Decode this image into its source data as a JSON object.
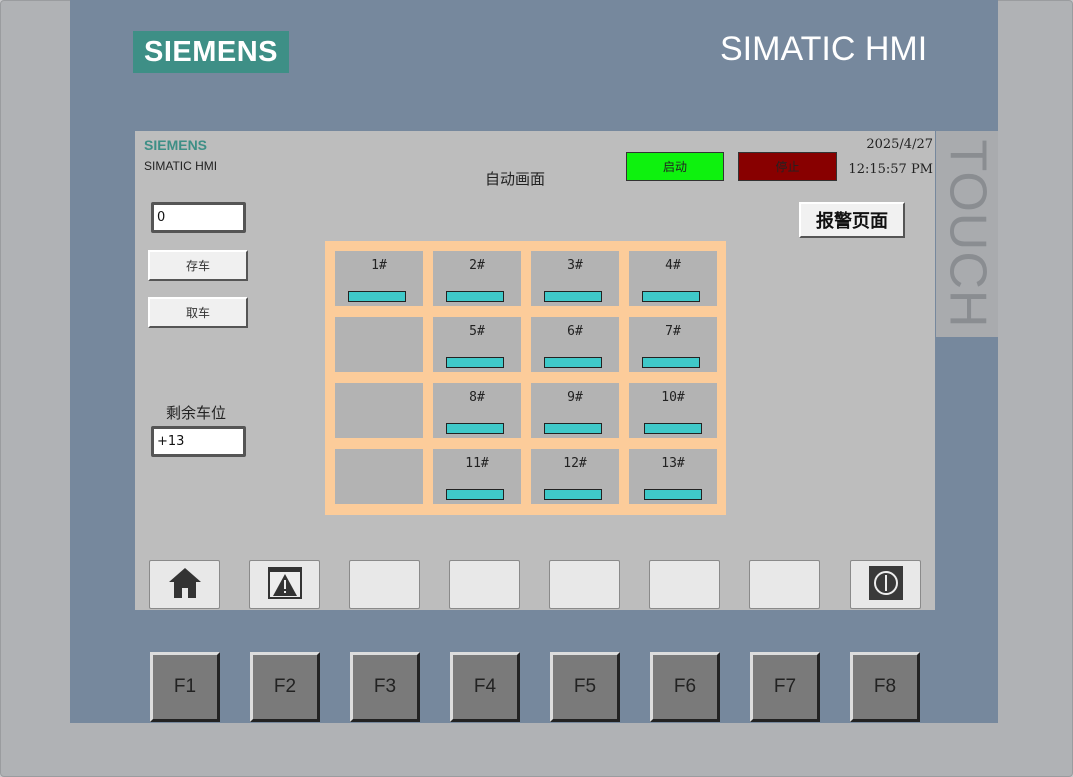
{
  "device": {
    "brand": "SIEMENS",
    "model": "SIMATIC HMI",
    "side_label": "TOUCH"
  },
  "screen": {
    "logo": "SIEMENS",
    "sub": "SIMATIC HMI",
    "title": "自动画面",
    "start_label": "启动",
    "stop_label": "停止",
    "date": "2025/4/27",
    "time": "12:15:57 PM",
    "alarm_page_label": "报警页面",
    "input_value": "0",
    "park_label": "存车",
    "pick_label": "取车",
    "remaining_label": "剩余车位",
    "remaining_value": "+13",
    "slots": [
      {
        "id": "1#"
      },
      {
        "id": "2#"
      },
      {
        "id": "3#"
      },
      {
        "id": "4#"
      },
      {
        "id": "5#"
      },
      {
        "id": "6#"
      },
      {
        "id": "7#"
      },
      {
        "id": "8#"
      },
      {
        "id": "9#"
      },
      {
        "id": "10#"
      },
      {
        "id": "11#"
      },
      {
        "id": "12#"
      },
      {
        "id": "13#"
      }
    ],
    "softkeys": [
      "home-icon",
      "alarm-icon",
      "",
      "",
      "",
      "",
      "",
      "power-icon"
    ]
  },
  "function_keys": [
    "F1",
    "F2",
    "F3",
    "F4",
    "F5",
    "F6",
    "F7",
    "F8"
  ],
  "colors": {
    "bezel": "#76889d",
    "screen_bg": "#bdbdbd",
    "start_green": "#0ef20e",
    "stop_red": "#880000",
    "grid_frame": "#fccc9a",
    "slot_indicator": "#3fc9c9",
    "brand_teal": "#3e8f86"
  }
}
